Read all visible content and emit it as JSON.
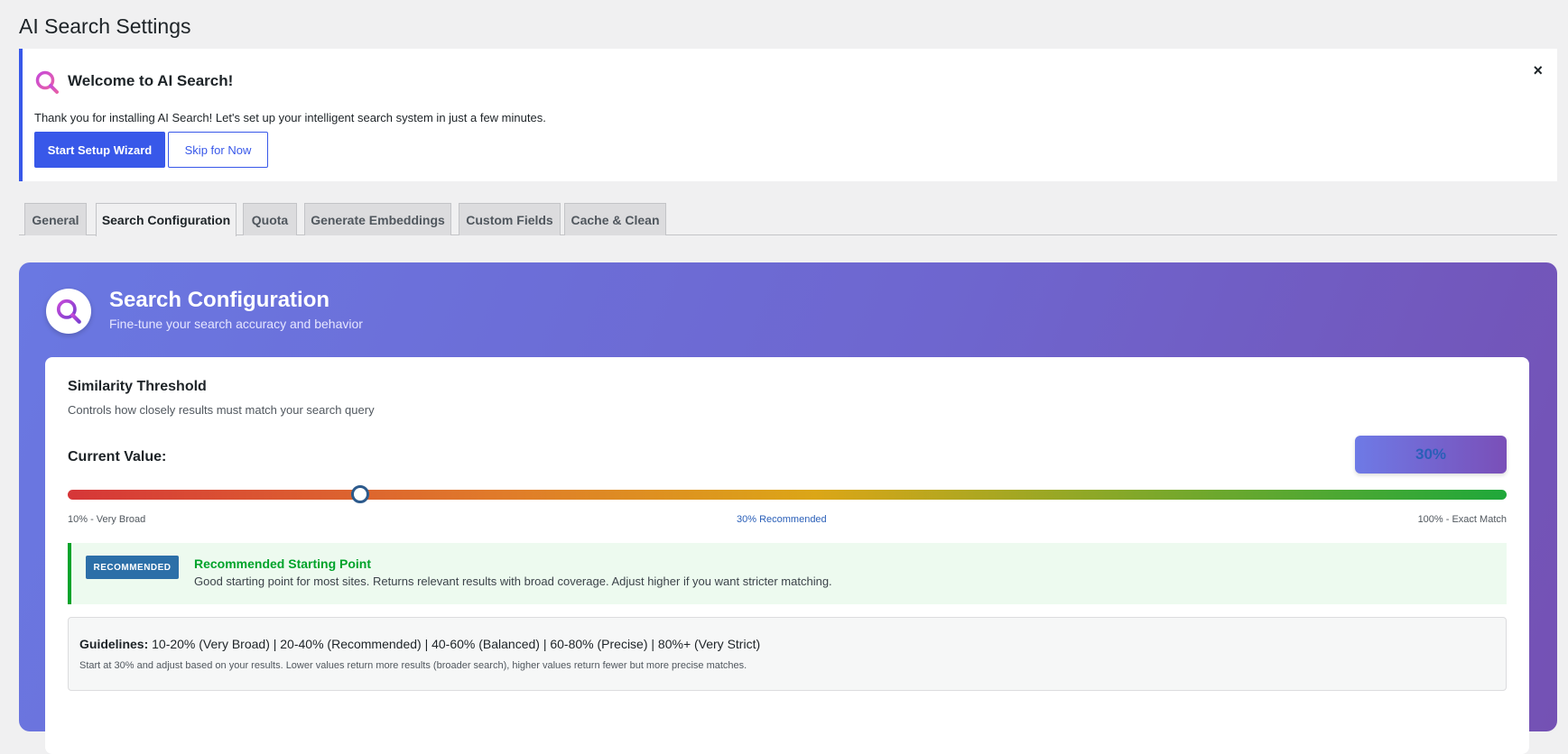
{
  "page": {
    "title": "AI Search Settings"
  },
  "notice": {
    "icon": "search-logo-icon",
    "title": "Welcome to AI Search!",
    "close_label": "×",
    "text": "Thank you for installing AI Search! Let's set up your intelligent search system in just a few minutes.",
    "primary_button": "Start Setup Wizard",
    "secondary_button": "Skip for Now"
  },
  "tabs": [
    {
      "label": "General",
      "active": false
    },
    {
      "label": "Search Configuration",
      "active": true
    },
    {
      "label": "Quota",
      "active": false
    },
    {
      "label": "Generate Embeddings",
      "active": false
    },
    {
      "label": "Custom Fields",
      "active": false
    },
    {
      "label": "Cache & Clean",
      "active": false
    }
  ],
  "panel": {
    "icon": "search-logo-icon",
    "title": "Search Configuration",
    "subtitle": "Fine-tune your search accuracy and behavior"
  },
  "threshold": {
    "title": "Similarity Threshold",
    "description": "Controls how closely results must match your search query",
    "current_label": "Current Value:",
    "value_display": "30%",
    "value": 30,
    "min": 10,
    "max": 100,
    "tick_min": "10% - Very Broad",
    "tick_mid": "30% Recommended",
    "tick_max": "100% - Exact Match"
  },
  "recommendation": {
    "badge": "RECOMMENDED",
    "title": "Recommended Starting Point",
    "text": "Good starting point for most sites. Returns relevant results with broad coverage. Adjust higher if you want stricter matching."
  },
  "guidelines": {
    "label": "Guidelines:",
    "text": " 10-20% (Very Broad) | 20-40% (Recommended) | 40-60% (Balanced) | 60-80% (Precise) | 80%+ (Very Strict)",
    "note": "Start at 30% and adjust based on your results. Lower values return more results (broader search), higher values return fewer but more precise matches."
  },
  "colors": {
    "accent": "#3858e9",
    "success": "#00a32a",
    "badge": "#2c6fa8"
  }
}
